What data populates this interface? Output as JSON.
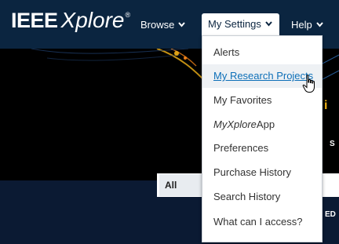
{
  "header": {
    "logo_brand": "IEEE",
    "logo_product": "Xplore",
    "logo_reg": "®",
    "nav": {
      "browse": "Browse",
      "my_settings": "My Settings",
      "help": "Help"
    }
  },
  "dropdown": {
    "items": [
      {
        "label": "Alerts"
      },
      {
        "label": "My Research Projects",
        "state": "hover"
      },
      {
        "label": "My Favorites"
      },
      {
        "label_italic": "MyXplore",
        "label_rest": "App"
      },
      {
        "label": "Preferences"
      },
      {
        "label": "Purchase History"
      },
      {
        "label": "Search History"
      },
      {
        "label": "What can I access?"
      }
    ]
  },
  "search": {
    "scope": "All"
  },
  "background_fragments": {
    "yellow": "i",
    "s": "S",
    "ed": "ED"
  },
  "icons": {
    "caret": "chevron-down-icon",
    "cursor": "hand-pointer-icon"
  },
  "colors": {
    "header_bg": "#0b2540",
    "link": "#0d6fb8",
    "hover_bg": "#eef1f4",
    "accent_yellow": "#f2b318"
  }
}
